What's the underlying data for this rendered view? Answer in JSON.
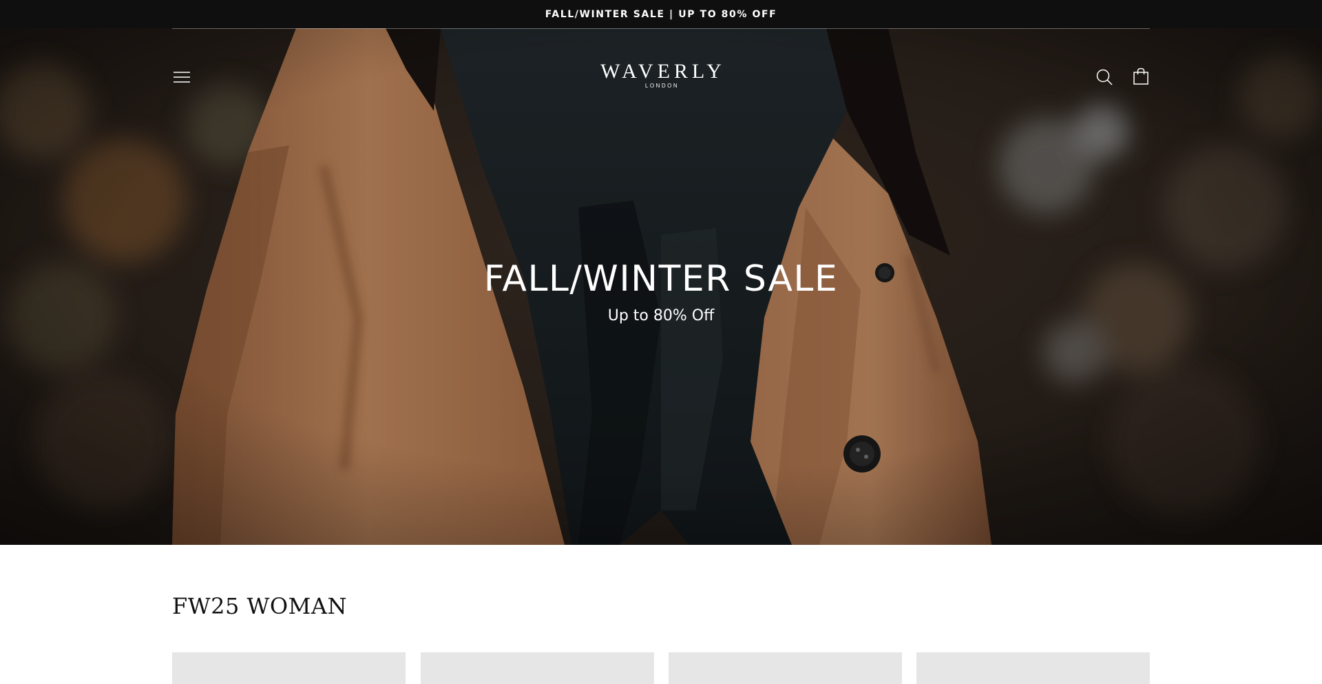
{
  "announcement": {
    "text": "FALL/WINTER SALE | UP TO 80% OFF"
  },
  "header": {
    "logo_main": "WAVERLY",
    "logo_sub": "LONDON",
    "icons": [
      "menu-icon",
      "search-icon",
      "cart-icon"
    ]
  },
  "hero": {
    "title": "FALL/WINTER SALE",
    "subtitle": "Up to 80% Off"
  },
  "collection": {
    "title": "FW25 WOMAN",
    "products": [
      {
        "name": ""
      },
      {
        "name": ""
      },
      {
        "name": ""
      },
      {
        "name": ""
      }
    ]
  },
  "colors": {
    "announcement_bg": "#0f0f0f",
    "text_light": "#ffffff",
    "coat": "#b57a52",
    "scarf": "#1c2226",
    "placeholder": "#e6e6e6"
  }
}
